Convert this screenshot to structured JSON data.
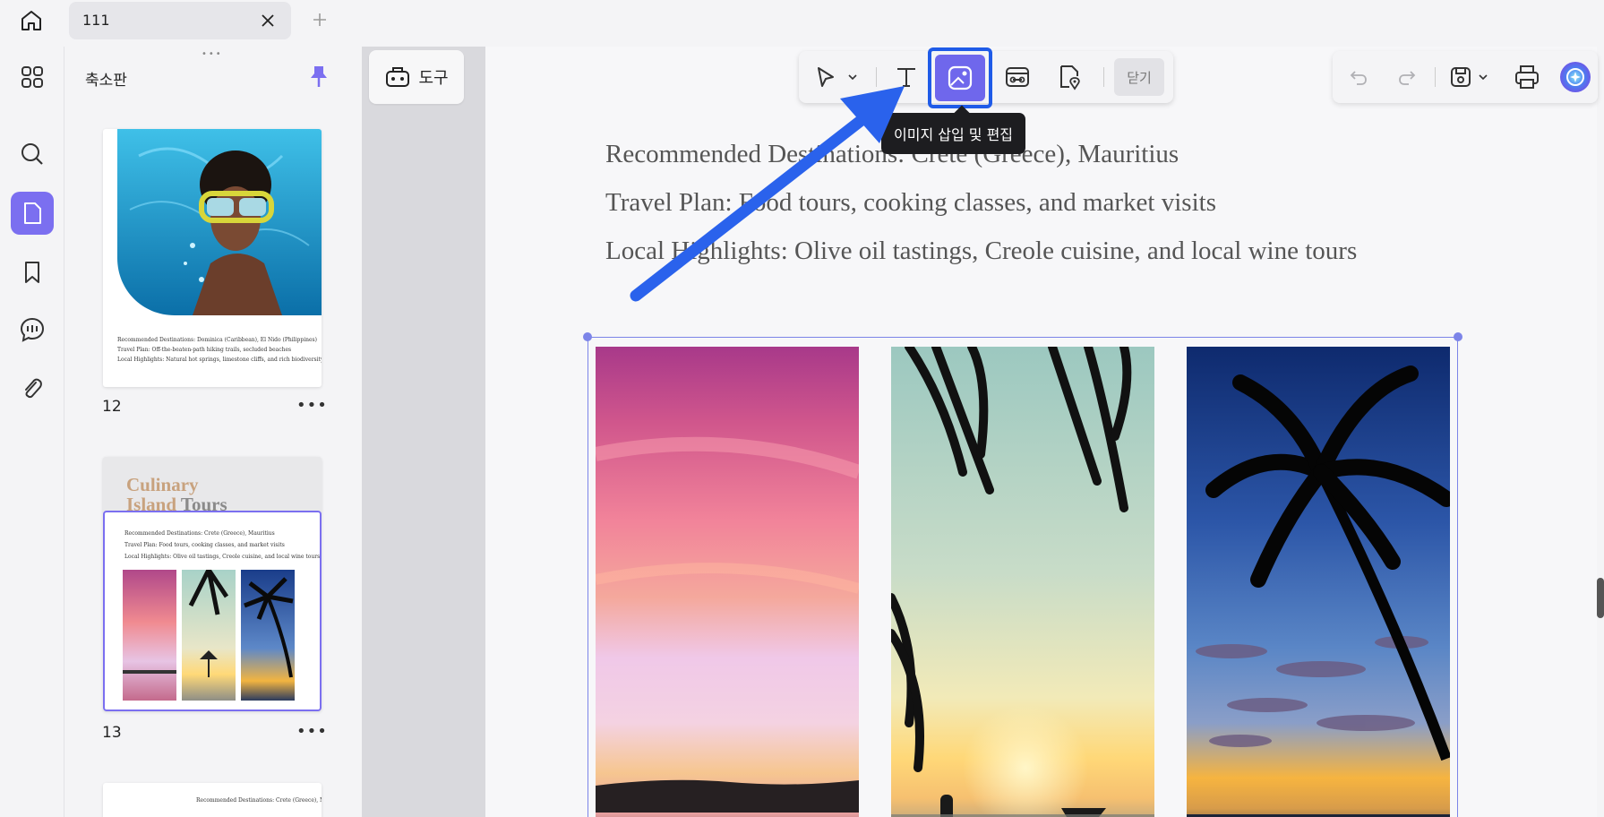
{
  "tabs": {
    "current_title": "111"
  },
  "thumbnails": {
    "title": "축소판",
    "pages": [
      {
        "number": "12",
        "lines": [
          "Recommended Destinations: Dominica (Caribbean), El Nido (Philippines)",
          "Travel Plan: Off-the-beaten-path hiking trails, secluded beaches",
          "Local Highlights: Natural hot springs, limestone cliffs, and rich biodiversity"
        ]
      },
      {
        "number": "13",
        "heading_line1": "Culinary",
        "heading_line2_a": "Island",
        "heading_line2_b": " Tours",
        "lines": [
          "Recommended Destinations: Crete (Greece), Mauritius",
          "Travel Plan: Food tours, cooking classes, and market visits",
          "Local Highlights: Olive oil tastings, Creole cuisine, and local wine tours"
        ]
      },
      {
        "number": "",
        "lines": [
          "Recommended Destinations: Crete (Greece), Mauritius"
        ]
      }
    ]
  },
  "tools": {
    "label": "도구"
  },
  "toolbar": {
    "close_label": "닫기",
    "tooltip": "이미지 삽입 및 편집"
  },
  "document": {
    "line1": "Recommended Destinations: Crete (Greece), Mauritius",
    "line2": "Travel Plan: Food tours, cooking classes, and market visits",
    "line3": "Local Highlights: Olive oil tastings, Creole cuisine, and local wine tours"
  },
  "colors": {
    "accent": "#7b6ff0",
    "highlight": "#1f5be8",
    "selection": "#7c84e8"
  }
}
